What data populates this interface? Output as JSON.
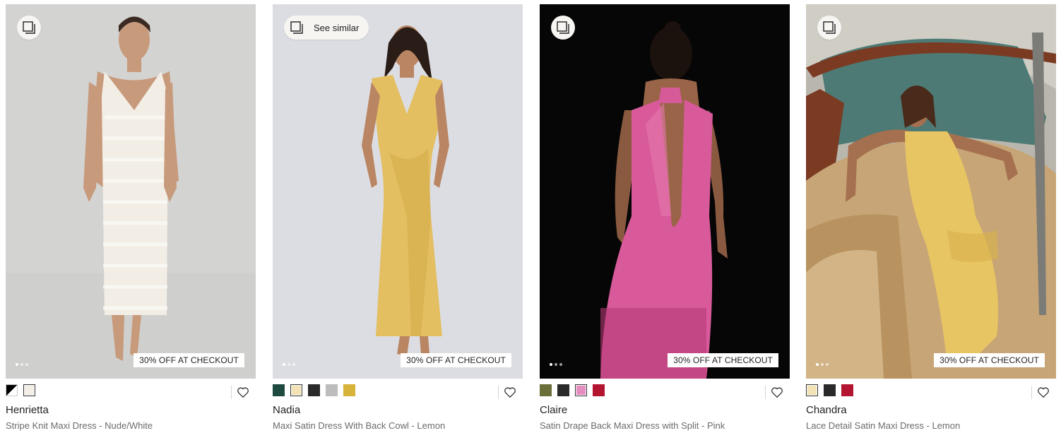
{
  "products": [
    {
      "name": "Henrietta",
      "description": "Stripe Knit Maxi Dress - Nude/White",
      "promo": "30% OFF AT CHECKOUT",
      "swatches": [
        "#000000/#ffffff",
        "#f3efe6"
      ],
      "selected_swatch": 1,
      "similar_icon": "see-similar-icon"
    },
    {
      "name": "Nadia",
      "description": "Maxi Satin Dress With Back Cowl - Lemon",
      "promo": "30% OFF AT CHECKOUT",
      "see_similar_label": "See similar",
      "swatches": [
        "#1f4a3f",
        "#f2e2b4",
        "#2a2a2a",
        "#bdbdbd",
        "#d8b33a"
      ],
      "selected_swatch": 1,
      "similar_icon": "see-similar-icon"
    },
    {
      "name": "Claire",
      "description": "Satin Drape Back Maxi Dress with Split - Pink",
      "promo": "30% OFF AT CHECKOUT",
      "swatches": [
        "#6b6f3a",
        "#2a2a2a",
        "#e58cc1",
        "#b31531"
      ],
      "selected_swatch": 2,
      "similar_icon": "see-similar-icon"
    },
    {
      "name": "Chandra",
      "description": "Lace Detail Satin Maxi Dress - Lemon",
      "promo": "30% OFF AT CHECKOUT",
      "swatches": [
        "#f2e2b4",
        "#2a2a2a",
        "#b31531"
      ],
      "selected_swatch": 0,
      "similar_icon": "see-similar-icon"
    }
  ],
  "icons": {
    "wishlist": "heart-icon",
    "similar": "see-similar-icon"
  }
}
